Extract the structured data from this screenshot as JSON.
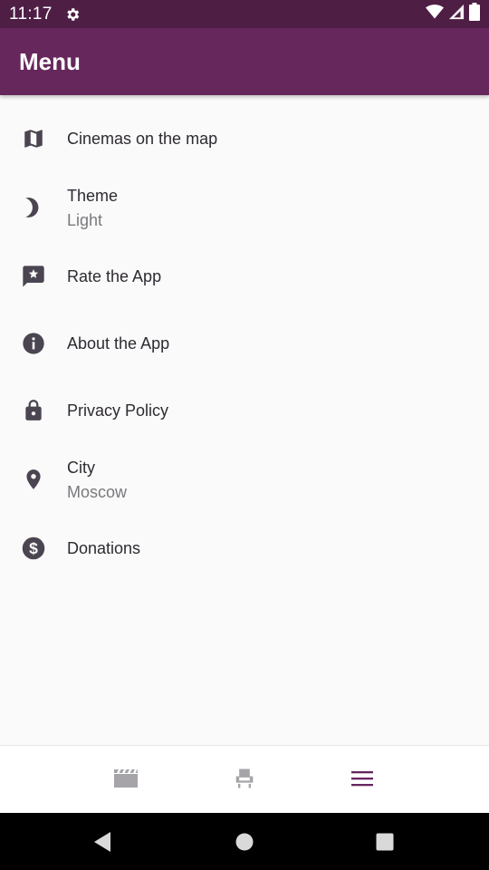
{
  "status_bar": {
    "time": "11:17",
    "icons": [
      "settings-gear-icon",
      "wifi-icon",
      "signal-icon",
      "battery-icon"
    ]
  },
  "app_bar": {
    "title": "Menu"
  },
  "menu": {
    "items": [
      {
        "label": "Cinemas on the map",
        "icon": "map-icon"
      },
      {
        "label": "Theme",
        "sublabel": "Light",
        "icon": "moon-icon"
      },
      {
        "label": "Rate the App",
        "icon": "rate-star-icon"
      },
      {
        "label": "About the App",
        "icon": "info-icon"
      },
      {
        "label": "Privacy Policy",
        "icon": "lock-icon"
      },
      {
        "label": "City",
        "sublabel": "Moscow",
        "icon": "location-pin-icon"
      },
      {
        "label": "Donations",
        "icon": "dollar-icon"
      }
    ]
  },
  "bottom_nav": {
    "tabs": [
      {
        "icon": "movie-clapper-icon",
        "active": false
      },
      {
        "icon": "cinema-seat-icon",
        "active": false
      },
      {
        "icon": "menu-hamburger-icon",
        "active": true
      }
    ],
    "active_color": "#66275c",
    "inactive_color": "#a6a4a8"
  },
  "system_nav": {
    "icons": [
      "back-icon",
      "home-icon",
      "recents-icon"
    ]
  },
  "colors": {
    "status_bar": "#4e1e45",
    "app_bar": "#66275c",
    "background": "#fafafa",
    "icon": "#4a4550"
  }
}
